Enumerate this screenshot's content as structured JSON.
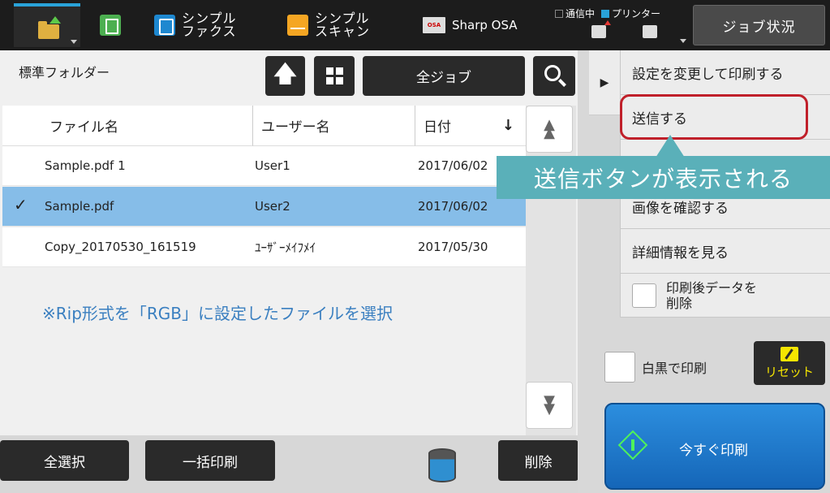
{
  "topbar": {
    "apps": [
      {
        "id": "copy",
        "label": ""
      },
      {
        "id": "fax",
        "label_line1": "シンプル",
        "label_line2": "ファクス"
      },
      {
        "id": "scan",
        "label_line1": "シンプル",
        "label_line2": "スキャン"
      },
      {
        "id": "osa",
        "label": "Sharp OSA",
        "icon_text": "OSA"
      }
    ],
    "status_comm": "通信中",
    "status_printer": "プリンター",
    "job_status": "ジョブ状況"
  },
  "folder": {
    "title": "標準フォルダー",
    "up_glyph": "🡅",
    "job_filter": "全ジョブ"
  },
  "table": {
    "headers": {
      "name": "ファイル名",
      "user": "ユーザー名",
      "date": "日付",
      "sort_glyph": "↓"
    },
    "rows": [
      {
        "name": "Sample.pdf 1",
        "user": "User1",
        "date": "2017/06/02",
        "selected": false,
        "check": ""
      },
      {
        "name": "Sample.pdf",
        "user": "User2",
        "date": "2017/06/02",
        "selected": true,
        "check": "✓"
      },
      {
        "name": "Copy_20170530_161519",
        "user": "ﾕｰｻﾞｰﾒｲﾌﾒｲ",
        "date": "2017/05/30",
        "selected": false,
        "check": ""
      }
    ]
  },
  "note": "※Rip形式を「RGB」に設定したファイルを選択",
  "scroll": {
    "up": "▲",
    "down": "▼"
  },
  "bottom": {
    "select_all": "全選択",
    "batch_print": "一括印刷",
    "delete": "削除"
  },
  "menu": {
    "collapse_glyph": "▶",
    "items": [
      {
        "label": "設定を変更して印刷する"
      },
      {
        "label": "送信する"
      },
      {
        "label": ""
      },
      {
        "label": "画像を確認する"
      },
      {
        "label": "詳細情報を見る"
      }
    ],
    "delete_after_print": {
      "line1": "印刷後データを",
      "line2": "削除"
    }
  },
  "callout": "送信ボタンが表示される",
  "bw_print": "白黒で印刷",
  "reset": "リセット",
  "print_now": "今すぐ印刷",
  "colors": {
    "accent_blue": "#29a3d9",
    "selected_row": "#86bde8",
    "highlight_red": "#c0202a",
    "callout_teal": "#5ab0b9",
    "print_button": "#2c8ede",
    "reset_yellow": "#f5e500"
  }
}
